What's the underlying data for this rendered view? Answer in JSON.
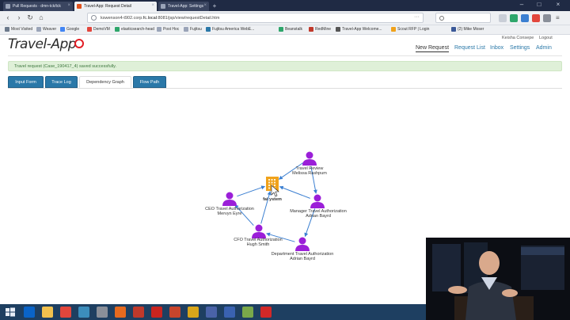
{
  "browser": {
    "tabs": [
      {
        "label": "Pull Requests · dmn-tck/tck",
        "active": false
      },
      {
        "label": "Travel-App: Request Detail",
        "active": true
      },
      {
        "label": "Travel-App: Settings",
        "active": false
      }
    ],
    "url_prefix": "kswenson4-t902.corp.",
    "url_host": "fc.local",
    "url_rest": ":8081/jsp/view/requestDetail.htm",
    "bookmarks": [
      {
        "label": "Most Visited",
        "icon": "gear-icon",
        "color": "#6c7a8c"
      },
      {
        "label": "Weaver",
        "icon": "page-icon",
        "color": "#9aa4b8"
      },
      {
        "label": "Google",
        "icon": "google-icon",
        "color": "#4285f4"
      },
      {
        "label": "DemoVM",
        "icon": "vm-icon",
        "color": "#e2463c"
      },
      {
        "label": "elasticsearch-head",
        "icon": "elastic-icon",
        "color": "#2ea66b"
      },
      {
        "label": "Post Hoc",
        "icon": "page-icon",
        "color": "#9aa4b8"
      },
      {
        "label": "Fujitsu",
        "icon": "page-icon",
        "color": "#9aa4b8"
      },
      {
        "label": "Fujitsu America WebE...",
        "icon": "globe-icon",
        "color": "#2a78a8"
      },
      {
        "label": "Beanstalk",
        "icon": "beanstalk-icon",
        "color": "#2ea66b"
      },
      {
        "label": "RedMine",
        "icon": "redmine-icon",
        "color": "#c0392b"
      },
      {
        "label": "Travel-App Welcome...",
        "icon": "globe-icon",
        "color": "#555"
      },
      {
        "label": "Scout RFP | Login",
        "icon": "scout-icon",
        "color": "#f0a21b"
      },
      {
        "label": "(2) Mike Moser",
        "icon": "facebook-icon",
        "color": "#3b5998"
      }
    ]
  },
  "app": {
    "logo": "Travel-App",
    "user_name": "Keisha Consepe",
    "logout": "Logout",
    "nav": [
      "New Request",
      "Request List",
      "Inbox",
      "Settings",
      "Admin"
    ],
    "alert": "Travel request (Case_190417_4) saved successfully.",
    "tabs": [
      "Input Form",
      "Trace Log",
      "Dependency Graph",
      "Flow Path"
    ],
    "active_tab": "Dependency Graph"
  },
  "graph": {
    "node_color": "#9b1fd8",
    "system_color": "#f0a21b",
    "edge_color": "#3b7fd1",
    "nodes": [
      {
        "id": "system",
        "type": "system",
        "lines": [
          "fai ystem"
        ]
      },
      {
        "id": "travel-review",
        "type": "person",
        "lines": [
          "Travel Review",
          "Melissa Rashpum"
        ]
      },
      {
        "id": "manager",
        "type": "person",
        "lines": [
          "Manager Travel Authorization",
          "Adrian Bayrd"
        ]
      },
      {
        "id": "department",
        "type": "person",
        "lines": [
          "Department Travel Authorization",
          "Adrian Bayrd"
        ]
      },
      {
        "id": "cfo",
        "type": "person",
        "lines": [
          "CFO Travel Authorization",
          "Hugh Smith"
        ]
      },
      {
        "id": "ceo",
        "type": "person",
        "lines": [
          "CEO Travel Authorization",
          "Mervyn Eyre"
        ]
      }
    ],
    "edges": [
      {
        "from": "travel-review",
        "to": "system"
      },
      {
        "from": "manager",
        "to": "system"
      },
      {
        "from": "travel-review",
        "to": "manager"
      },
      {
        "from": "manager",
        "to": "department"
      },
      {
        "from": "department",
        "to": "cfo"
      },
      {
        "from": "cfo",
        "to": "system"
      },
      {
        "from": "ceo",
        "to": "system"
      },
      {
        "from": "cfo",
        "to": "ceo"
      }
    ]
  },
  "taskbar": {
    "apps": [
      {
        "name": "outlook",
        "color": "#0a64c8"
      },
      {
        "name": "explorer",
        "color": "#f2c14e"
      },
      {
        "name": "chrome",
        "color": "#e2463c"
      },
      {
        "name": "office",
        "color": "#3c8dbc"
      },
      {
        "name": "settings",
        "color": "#8a8f99"
      },
      {
        "name": "firefox",
        "color": "#e66a1f"
      },
      {
        "name": "calendar",
        "color": "#c0392b"
      },
      {
        "name": "acrobat",
        "color": "#c9241f"
      },
      {
        "name": "powerpoint",
        "color": "#c8452c"
      },
      {
        "name": "filezilla",
        "color": "#d9a61a"
      },
      {
        "name": "shipping",
        "color": "#4a63a8"
      },
      {
        "name": "save",
        "color": "#3a62b0"
      },
      {
        "name": "notepad",
        "color": "#7aa84a"
      },
      {
        "name": "app",
        "color": "#d22828"
      }
    ]
  }
}
